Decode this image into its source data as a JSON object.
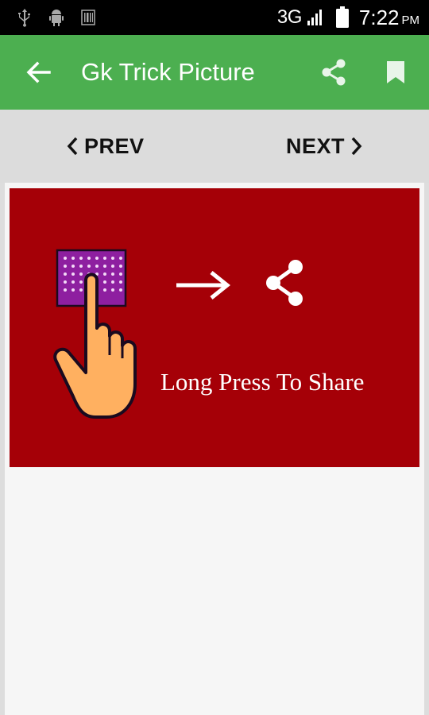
{
  "status_bar": {
    "network": "3G",
    "time": "7:22",
    "ampm": "PM",
    "icons": [
      "usb-icon",
      "android-debug-icon",
      "barcode-icon",
      "signal-icon",
      "battery-icon"
    ]
  },
  "app_bar": {
    "title": "Gk Trick Picture",
    "back_icon": "arrow-left-icon",
    "share_icon": "share-icon",
    "bookmark_icon": "bookmark-icon",
    "background": "#4caf50"
  },
  "navigation": {
    "prev_label": "PREV",
    "next_label": "NEXT"
  },
  "content": {
    "image": {
      "background": "#a50007",
      "caption": "Long Press To Share",
      "icons": [
        "keypad-hand-icon",
        "arrow-right-icon",
        "share-icon"
      ]
    }
  }
}
